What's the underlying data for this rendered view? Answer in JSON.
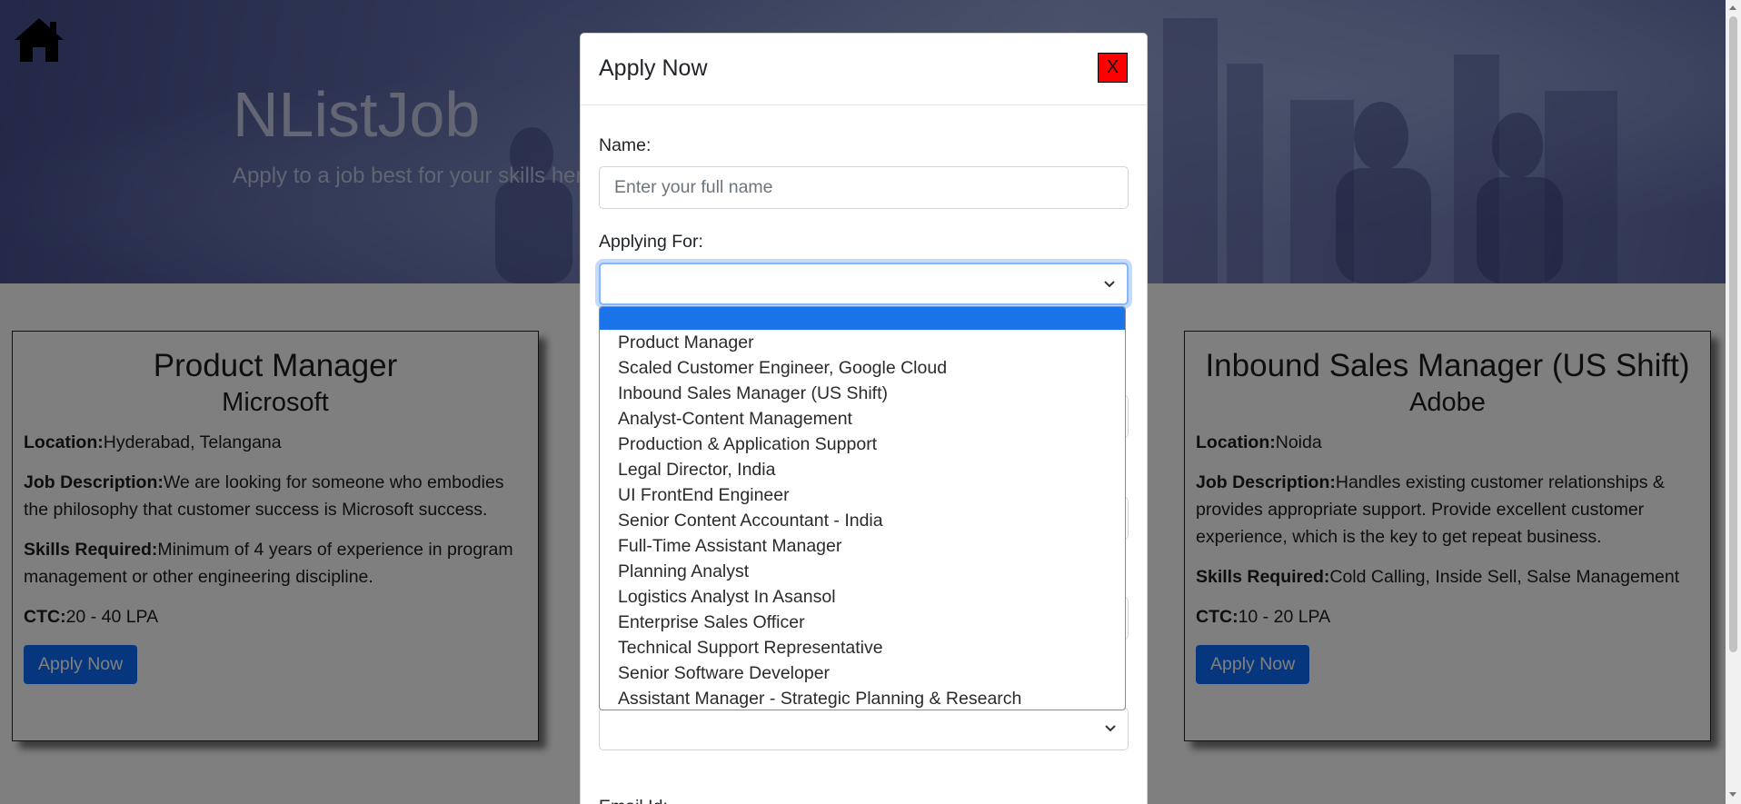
{
  "site": {
    "brand": "NListJob",
    "tagline": "Apply to a job best for your skills here"
  },
  "jobs": [
    {
      "title": "Product Manager",
      "company": "Microsoft",
      "location_label": "Location:",
      "location": "Hyderabad, Telangana",
      "description_label": "Job Description:",
      "description": "We are looking for someone who embodies the philosophy that customer success is Microsoft success.",
      "skills_label": "Skills Required:",
      "skills": "Minimum of 4 years of experience in program management or other engineering discipline.",
      "ctc_label": "CTC:",
      "ctc": "20 - 40 LPA",
      "apply_label": "Apply Now"
    },
    {
      "title": "Inbound Sales Manager (US Shift)",
      "company": "Adobe",
      "location_label": "Location:",
      "location": "Noida",
      "description_label": "Job Description:",
      "description": "Handles existing customer relationships & provides appropriate support. Provide excellent customer experience, which is the key to get repeat business.",
      "skills_label": "Skills Required:",
      "skills": "Cold Calling, Inside Sell, Salse Management",
      "ctc_label": "CTC:",
      "ctc": "10 - 20 LPA",
      "apply_label": "Apply Now"
    }
  ],
  "modal": {
    "title": "Apply Now",
    "close_label": "X",
    "name_label": "Name:",
    "name_placeholder": "Enter your full name",
    "name_value": "",
    "applying_label": "Applying For:",
    "applying_value": "",
    "bottom_label": "Email Id:"
  },
  "dropdown": {
    "options": [
      "",
      "Product Manager",
      "Scaled Customer Engineer, Google Cloud",
      "Inbound Sales Manager (US Shift)",
      "Analyst-Content Management",
      "Production & Application Support",
      "Legal Director, India",
      "UI FrontEnd Engineer",
      "Senior Content Accountant - India",
      "Full-Time Assistant Manager",
      "Planning Analyst",
      "Logistics Analyst In Asansol",
      "Enterprise Sales Officer",
      "Technical Support Representative",
      "Senior Software Developer",
      "Assistant Manager - Strategic Planning & Research"
    ],
    "highlight_color": "#1a73e8"
  },
  "colors": {
    "primary_button": "#0d6efd",
    "close_button": "#ff0000",
    "focus_ring": "#86b7fe"
  },
  "icons": {
    "home": "home-icon",
    "chevron": "chevron-down-icon"
  }
}
